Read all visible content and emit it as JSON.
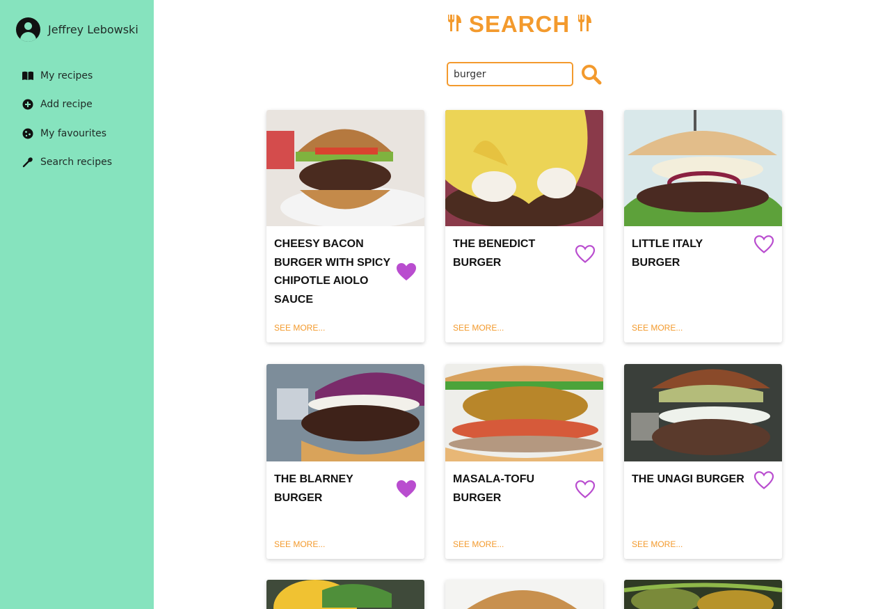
{
  "user": {
    "name": "Jeffrey Lebowski"
  },
  "nav": [
    {
      "label": "My recipes",
      "icon": "book-icon"
    },
    {
      "label": "Add recipe",
      "icon": "plus-circle-icon"
    },
    {
      "label": "My favourites",
      "icon": "cookie-icon"
    },
    {
      "label": "Search recipes",
      "icon": "spoon-icon"
    }
  ],
  "header": {
    "title": "SEARCH",
    "icon": "utensils-icon"
  },
  "search": {
    "value": "burger",
    "button_icon": "search-icon"
  },
  "recipes": [
    {
      "title": "Cheesy Bacon Burger with Spicy Chipotle Aiolo Sauce",
      "favourite": true,
      "see_more": "See more..."
    },
    {
      "title": "The Benedict Burger",
      "favourite": false,
      "see_more": "See more..."
    },
    {
      "title": "Little Italy Burger",
      "favourite": false,
      "see_more": "See more..."
    },
    {
      "title": "The Blarney Burger",
      "favourite": true,
      "see_more": "See more..."
    },
    {
      "title": "Masala-Tofu Burger",
      "favourite": false,
      "see_more": "See more..."
    },
    {
      "title": "The Unagi Burger",
      "favourite": false,
      "see_more": "See more..."
    }
  ],
  "colors": {
    "sidebar": "#86e3be",
    "accent": "#f39a2d",
    "heart": "#b94dcf"
  }
}
